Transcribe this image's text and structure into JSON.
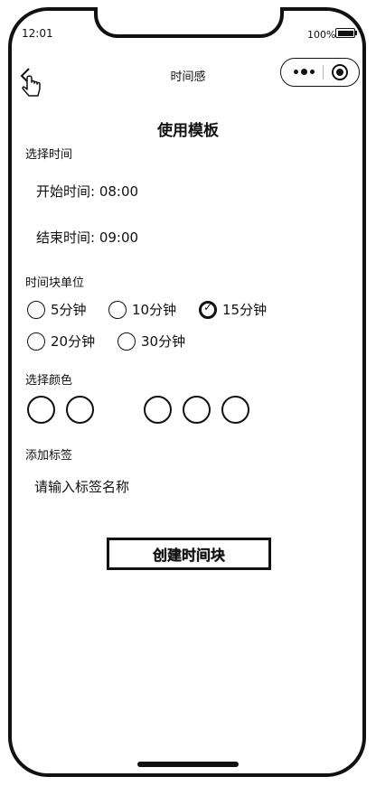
{
  "status": {
    "time": "12:01",
    "battery": "100%"
  },
  "nav": {
    "title": "时间感"
  },
  "page": {
    "heading": "使用模板"
  },
  "time_section": {
    "label": "选择时间",
    "start": "开始时间: 08:00",
    "end": "结束时间: 09:00"
  },
  "unit_section": {
    "label": "时间块单位",
    "options": [
      "5分钟",
      "10分钟",
      "15分钟",
      "20分钟",
      "30分钟"
    ],
    "selected": "15分钟"
  },
  "color_section": {
    "label": "选择颜色",
    "swatch_count": 5
  },
  "tag_section": {
    "label": "添加标签",
    "placeholder": "请输入标签名称"
  },
  "actions": {
    "create": "创建时间块"
  },
  "icons": [
    "back-chevron-icon",
    "hand-pointer-icon",
    "more-icon",
    "target-icon",
    "battery-icon"
  ]
}
